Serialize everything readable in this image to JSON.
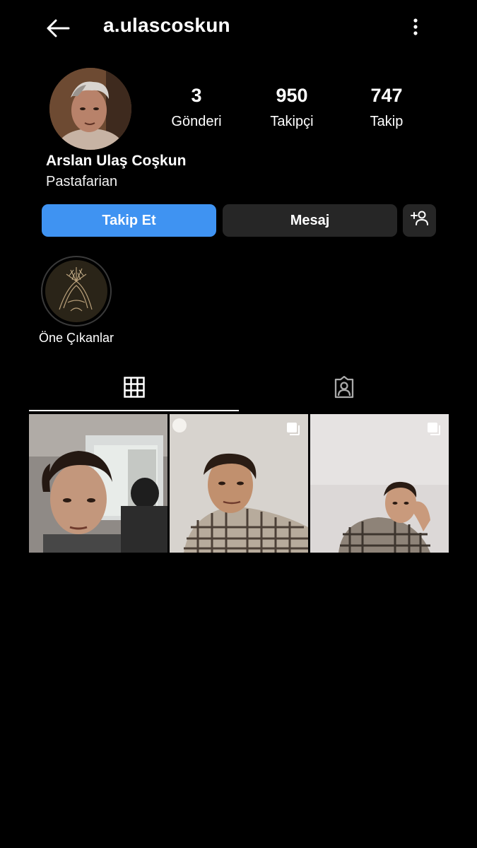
{
  "header": {
    "username": "a.ulascoskun"
  },
  "profile": {
    "full_name": "Arslan Ulaş Coşkun",
    "bio": "Pastafarian",
    "stats": [
      {
        "value": "3",
        "label": "Gönderi"
      },
      {
        "value": "950",
        "label": "Takipçi"
      },
      {
        "value": "747",
        "label": "Takip"
      }
    ]
  },
  "actions": {
    "follow_label": "Takip Et",
    "message_label": "Mesaj",
    "add_user_icon": "add-person-icon"
  },
  "highlights": [
    {
      "label": "Öne Çıkanlar"
    }
  ],
  "tabs": [
    {
      "icon": "grid-icon",
      "selected": true
    },
    {
      "icon": "tagged-icon",
      "selected": false
    }
  ],
  "posts": [
    {
      "type": "photo"
    },
    {
      "type": "carousel"
    },
    {
      "type": "carousel"
    }
  ],
  "colors": {
    "background": "#000000",
    "follow_button": "#3f93f2",
    "secondary_button": "#262626"
  }
}
